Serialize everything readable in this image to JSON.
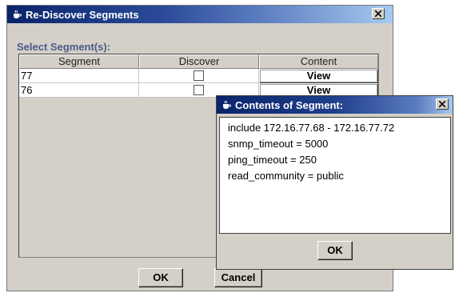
{
  "main_dialog": {
    "title": "Re-Discover Segments",
    "select_label": "Select Segment(s):",
    "columns": [
      "Segment",
      "Discover",
      "Content"
    ],
    "rows": [
      {
        "segment": "77",
        "discover_checked": false,
        "content_button": "View"
      },
      {
        "segment": "76",
        "discover_checked": false,
        "content_button": "View"
      }
    ],
    "ok_label": "OK",
    "cancel_label": "Cancel",
    "close_icon": "close-icon",
    "title_icon": "java-cup-icon"
  },
  "content_dialog": {
    "title": "Contents of Segment:",
    "lines": [
      "include 172.16.77.68 - 172.16.77.72",
      "snmp_timeout = 5000",
      "ping_timeout = 250",
      "read_community = public"
    ],
    "ok_label": "OK",
    "close_icon": "close-icon",
    "title_icon": "java-cup-icon"
  },
  "colors": {
    "title_gradient_start": "#0a246a",
    "title_gradient_end": "#a6caf0",
    "window_bg": "#d4d0c8",
    "label_color": "#4a5a8a"
  }
}
